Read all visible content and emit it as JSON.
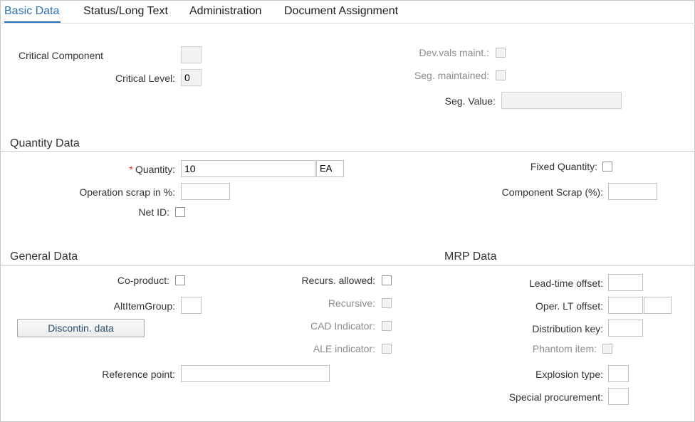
{
  "tabs": [
    {
      "label": "Basic Data",
      "active": true
    },
    {
      "label": "Status/Long Text",
      "active": false
    },
    {
      "label": "Administration",
      "active": false
    },
    {
      "label": "Document Assignment",
      "active": false
    }
  ],
  "basic": {
    "critical_component_label": "Critical Component",
    "critical_level_label": "Critical Level:",
    "critical_level_value": "0",
    "dev_vals_maint_label": "Dev.vals maint.:",
    "seg_maintained_label": "Seg. maintained:",
    "seg_value_label": "Seg. Value:"
  },
  "quantity": {
    "section_title": "Quantity Data",
    "required_marker": "*",
    "quantity_label": "Quantity:",
    "quantity_value": "10",
    "unit_value": "EA",
    "op_scrap_label": "Operation scrap in %:",
    "net_id_label": "Net ID:",
    "fixed_quantity_label": "Fixed Quantity:",
    "component_scrap_label": "Component Scrap (%):"
  },
  "general": {
    "section_title": "General Data",
    "co_product_label": "Co-product:",
    "alt_item_group_label": "AltItemGroup:",
    "discontin_button": "Discontin. data",
    "recurs_allowed_label": "Recurs. allowed:",
    "recursive_label": "Recursive:",
    "cad_indicator_label": "CAD Indicator:",
    "ale_indicator_label": "ALE indicator:",
    "reference_point_label": "Reference point:"
  },
  "mrp": {
    "section_title": "MRP Data",
    "lead_time_offset_label": "Lead-time offset:",
    "oper_lt_offset_label": "Oper. LT offset:",
    "distribution_key_label": "Distribution key:",
    "phantom_item_label": "Phantom item:",
    "explosion_type_label": "Explosion type:",
    "special_procurement_label": "Special procurement:"
  },
  "colors": {
    "accent": "#2a72b5",
    "required": "#e52929",
    "disabled_text": "#8c8c8c"
  }
}
